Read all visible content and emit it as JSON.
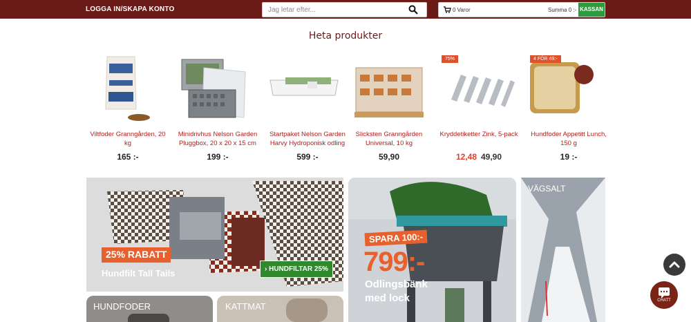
{
  "header": {
    "login_label": "LOGGA IN/SKAPA KONTO",
    "search_placeholder": "Jag letar efter...",
    "cart_count": "0 Varor",
    "cart_sum": "Summa  0 :-",
    "checkout_label": "KASSAN"
  },
  "hot_products": {
    "title": "Heta produkter",
    "items": [
      {
        "name": "Viltfoder Granngården, 20 kg",
        "price": "165 :-",
        "badge": "",
        "old_price": ""
      },
      {
        "name": "Minidrivhus Nelson Garden Pluggbox, 20 x 20 x 15 cm",
        "price": "199 :-",
        "badge": "",
        "old_price": ""
      },
      {
        "name": "Startpaket Nelson Garden Harvy Hydroponisk odling",
        "price": "599 :-",
        "badge": "",
        "old_price": ""
      },
      {
        "name": "Slicksten Granngården Universal, 10 kg",
        "price": "59,90",
        "badge": "",
        "old_price": ""
      },
      {
        "name": "Kryddetiketter Zink, 5-pack",
        "price": "12,48",
        "badge": "75%",
        "old_price": "49,90"
      },
      {
        "name": "Hundfoder Appetitt Lunch, 150 g",
        "price": "19 :-",
        "badge": "4 FÖR 49:-",
        "old_price": ""
      }
    ]
  },
  "banners": {
    "tall_tails": {
      "discount": "25% RABATT",
      "subtitle": "Hundfilt Tall Tails",
      "button": "› HUNDFILTAR 25%"
    },
    "odlingsbank": {
      "tag": "SPARA 100:-",
      "price": "799:-",
      "line1": "Odlingsbänk",
      "line2": "med lock"
    },
    "vagsalt": {
      "label": "VÄGSALT"
    },
    "hundfoder": {
      "label": "HUNDFODER"
    },
    "kattmat": {
      "label": "KATTMAT"
    }
  },
  "chat": {
    "label": "CHATT"
  },
  "colors": {
    "brand": "#6b1b17",
    "accent_red": "#b3201e",
    "sale": "#e03d25",
    "green": "#2c9b3c"
  }
}
